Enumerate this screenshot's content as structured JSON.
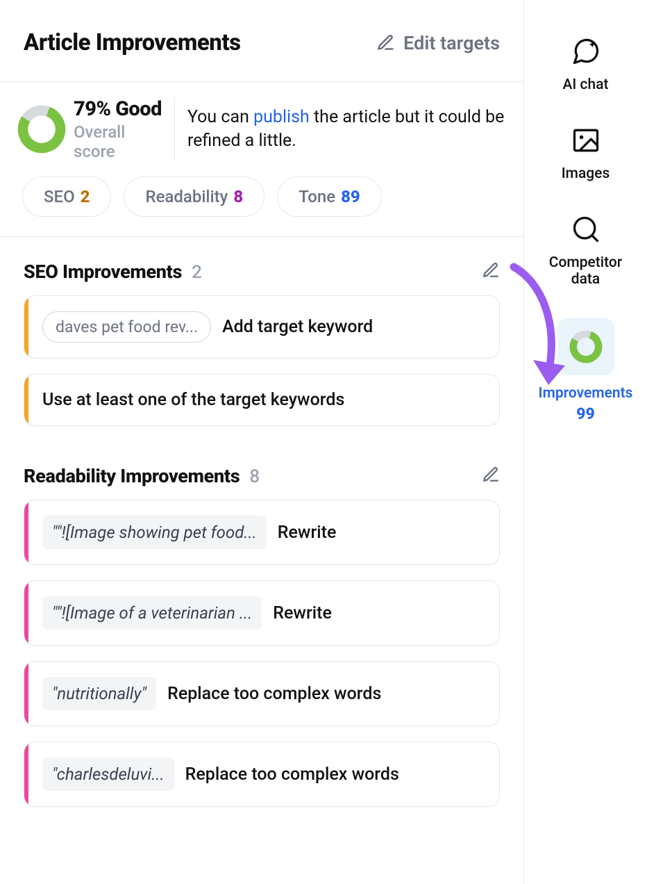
{
  "header": {
    "title": "Article Improvements",
    "edit_targets_label": "Edit targets"
  },
  "score": {
    "percent": 79,
    "percent_label": "79% Good",
    "subtitle": "Overall score",
    "blurb_pre": "You can ",
    "blurb_link": "publish",
    "blurb_post": " the article but it could be refined a little."
  },
  "chips": {
    "seo": {
      "label": "SEO",
      "value": "2"
    },
    "readability": {
      "label": "Readability",
      "value": "8"
    },
    "tone": {
      "label": "Tone",
      "value": "89"
    }
  },
  "seo_section": {
    "title": "SEO Improvements",
    "count": "2",
    "items": [
      {
        "pill": "daves pet food rev...",
        "text": "Add target keyword"
      },
      {
        "text": "Use at least one of the target keywords"
      }
    ]
  },
  "readability_section": {
    "title": "Readability Improvements",
    "count": "8",
    "items": [
      {
        "quote": "\"\"![Image showing pet food...",
        "text": "Rewrite"
      },
      {
        "quote": "\"\"![Image of a veterinarian ...",
        "text": "Rewrite"
      },
      {
        "quote": "\"nutritionally\"",
        "text": "Replace too complex words"
      },
      {
        "quote": "\"charlesdeluvi...",
        "text": "Replace too complex words"
      }
    ]
  },
  "sidebar": {
    "ai_chat": {
      "label": "AI chat"
    },
    "images": {
      "label": "Images"
    },
    "competitor_data": {
      "label": "Competitor\ndata"
    },
    "improvements": {
      "label": "Improvements",
      "value": "99"
    }
  },
  "colors": {
    "ring_green": "#7cc242",
    "ring_grey": "#d1d5db",
    "accent_blue": "#2563eb",
    "arrow_purple": "#9b5cf0"
  }
}
